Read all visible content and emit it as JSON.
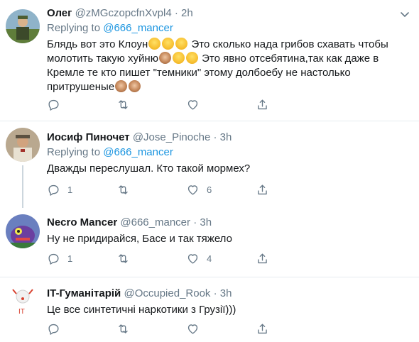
{
  "tweets": [
    {
      "name": "Олег",
      "handle": "@zMGczopcfnXvpl4",
      "dot": "·",
      "time": "2h",
      "replying_prefix": "Replying to",
      "mention": "@666_mancer",
      "text_parts": [
        "Блядь вот это Клоун",
        " Это сколько нада грибов схавать чтобы молотить такую хуйню",
        " Это явно отсебятина,так как даже в Кремле те кто пишет \"темники\" этому долбоебу не настолько притрушеные"
      ],
      "replies": "",
      "retweets": "",
      "likes": ""
    },
    {
      "name": "Иосиф Пиночет",
      "handle": "@Jose_Pinoche",
      "dot": "·",
      "time": "3h",
      "replying_prefix": "Replying to",
      "mention": "@666_mancer",
      "text": "Дважды переслушал. Кто такой мормех?",
      "replies": "1",
      "retweets": "",
      "likes": "6"
    },
    {
      "name": "Necro Mancer",
      "handle": "@666_mancer",
      "dot": "·",
      "time": "3h",
      "text": "Ну не придирайся, Басе и так тяжело",
      "replies": "1",
      "retweets": "",
      "likes": "4"
    },
    {
      "name": "IT-Гуманітарій",
      "handle": "@Occupied_Rook",
      "dot": "·",
      "time": "3h",
      "text": "Це все синтетичні наркотики з Грузії)))",
      "replies": "",
      "retweets": "",
      "likes": ""
    }
  ],
  "icons": {
    "reply": "reply-icon",
    "retweet": "retweet-icon",
    "like": "heart-icon",
    "share": "share-icon",
    "more": "chevron-down-icon"
  },
  "colors": {
    "link": "#1b95e0",
    "secondary": "#657786",
    "divider": "#e6ecf0"
  }
}
